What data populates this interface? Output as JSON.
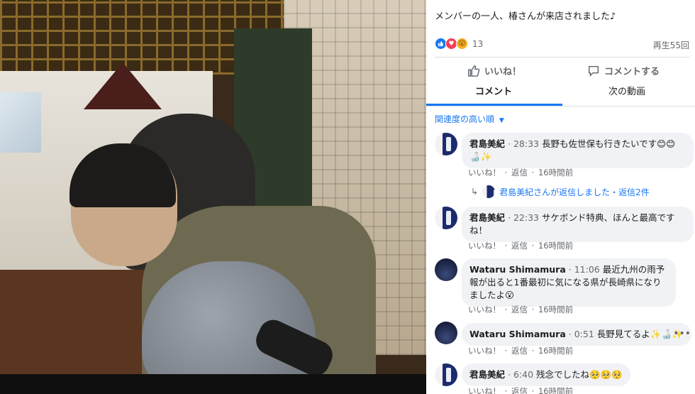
{
  "post": {
    "caption": "メンバーの一人、椿さんが来店されました♪",
    "reaction_count": "13",
    "views": "再生55回"
  },
  "actions": {
    "like": "いいね！",
    "comment": "コメントする"
  },
  "tabs": [
    {
      "label": "コメント"
    },
    {
      "label": "次の動画"
    }
  ],
  "sort_label": "関連度の高い順",
  "comments": [
    {
      "name": "君島美紀",
      "time": "28:33",
      "text": "長野も佐世保も行きたいです😊😊🍶✨",
      "like": "いいね！",
      "reply": "返信",
      "ago": "16時間前"
    },
    {
      "name": "君島美紀",
      "time": "22:33",
      "text": "サケボンド特典、ほんと最高ですね！",
      "like": "いいね！",
      "reply": "返信",
      "ago": "16時間前"
    },
    {
      "name": "Wataru Shimamura",
      "time": "11:06",
      "text": "最近九州の雨予報が出ると1番最初に気になる県が長崎県になりましたよ😮",
      "like": "いいね！",
      "reply": "返信",
      "ago": "16時間前"
    },
    {
      "name": "Wataru Shimamura",
      "time": "0:51",
      "text": "長野見てるよ✨🍶✨",
      "like": "いいね！",
      "reply": "返信",
      "ago": "16時間前"
    },
    {
      "name": "君島美紀",
      "time": "6:40",
      "text": "残念でしたね🥺🥺🥺",
      "like": "いいね！",
      "reply": "返信",
      "ago": "16時間前"
    }
  ],
  "reply_summary": "君島美紀さんが返信しました・返信2件",
  "separator": "·"
}
